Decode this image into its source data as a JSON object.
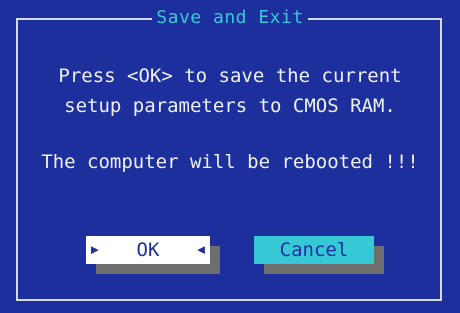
{
  "dialog": {
    "title": "Save and Exit",
    "message_line1": "Press <OK> to save the current",
    "message_line2": "setup parameters to CMOS RAM.",
    "warning": "The computer will be rebooted !!!"
  },
  "buttons": {
    "ok_label": "OK",
    "cancel_label": "Cancel",
    "selected": "OK"
  },
  "icons": {
    "selector_left": "right-pointing-triangle",
    "selector_right": "left-pointing-triangle"
  },
  "colors": {
    "background": "#1c2f9c",
    "title": "#37c8d6",
    "text": "#eef1f8",
    "ok_button": "#ffffff",
    "cancel_button": "#37c8d6",
    "shadow": "#6e6e6e"
  }
}
